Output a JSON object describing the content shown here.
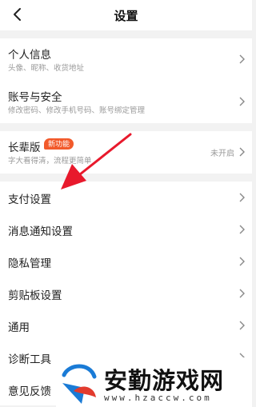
{
  "header": {
    "title": "设置",
    "back_icon": "chevron-left-icon"
  },
  "groups": [
    {
      "items": [
        {
          "label": "个人信息",
          "sub": "头像、昵称、收货地址"
        },
        {
          "label": "账号与安全",
          "sub": "修改密码、修改手机号码、账号绑定管理"
        }
      ]
    },
    {
      "items": [
        {
          "label": "长辈版",
          "badge": "新功能",
          "sub": "字大看得清，流程更简单",
          "status": "未开启"
        }
      ]
    },
    {
      "items": [
        {
          "label": "支付设置"
        },
        {
          "label": "消息通知设置"
        },
        {
          "label": "隐私管理"
        },
        {
          "label": "剪贴板设置"
        },
        {
          "label": "通用"
        },
        {
          "label": "诊断工具"
        },
        {
          "label": "意见反馈"
        }
      ]
    }
  ],
  "watermark": {
    "title": "安勤游戏网",
    "url": "www.hzaccw.com",
    "colors": {
      "blue": "#1a7bd6",
      "red": "#e23b2e"
    }
  },
  "colors": {
    "accent": "#f25a2b",
    "arrow": "#e8192c",
    "background": "#f2f2f2"
  }
}
